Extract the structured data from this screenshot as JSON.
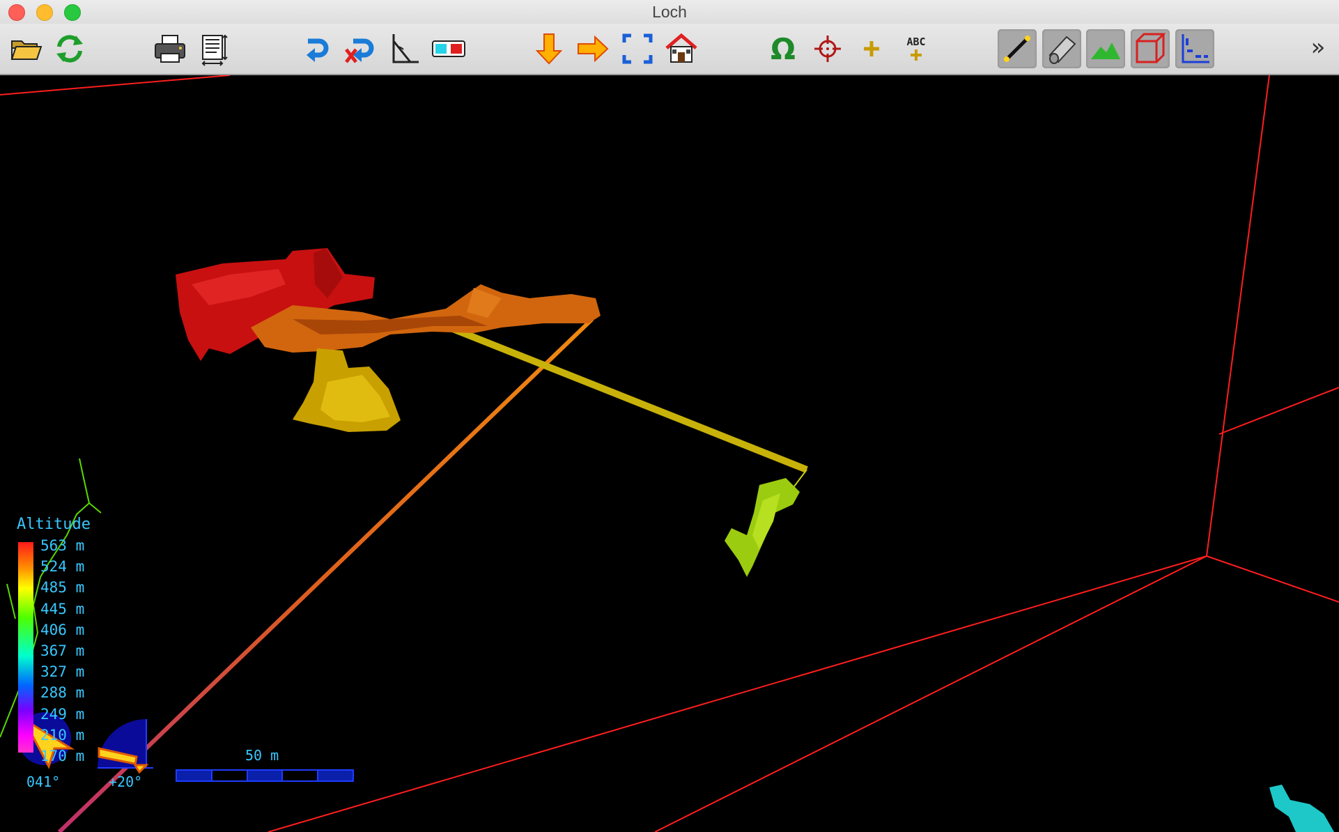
{
  "window": {
    "title": "Loch"
  },
  "toolbar": {
    "buttons": [
      {
        "name": "open",
        "icon": "folder-open-icon"
      },
      {
        "name": "reload",
        "icon": "reload-icon"
      },
      {
        "name": "print",
        "icon": "printer-icon"
      },
      {
        "name": "page-setup",
        "icon": "page-setup-icon"
      },
      {
        "name": "rotate",
        "icon": "rotate-icon"
      },
      {
        "name": "cancel-rotation",
        "icon": "stop-rotate-icon"
      },
      {
        "name": "perspective",
        "icon": "perspective-icon"
      },
      {
        "name": "anaglyph",
        "icon": "3d-glasses-icon"
      },
      {
        "name": "view-plan",
        "icon": "arrow-down-icon"
      },
      {
        "name": "view-elevation",
        "icon": "arrow-right-icon"
      },
      {
        "name": "zoom-to-fit",
        "icon": "fit-to-screen-icon"
      },
      {
        "name": "home",
        "icon": "home-icon"
      },
      {
        "name": "highlight-entrances",
        "icon": "omega-icon"
      },
      {
        "name": "highlight-fixed-points",
        "icon": "crosshair-icon"
      },
      {
        "name": "highlight-stations",
        "icon": "plus-icon"
      },
      {
        "name": "show-labels",
        "icon": "abc-labels-icon"
      },
      {
        "name": "show-centerline",
        "icon": "centerline-icon",
        "pressed": true
      },
      {
        "name": "show-walls",
        "icon": "tube-walls-icon",
        "pressed": true
      },
      {
        "name": "show-surface",
        "icon": "surface-icon",
        "pressed": true
      },
      {
        "name": "show-bounding-box",
        "icon": "bounding-box-icon",
        "pressed": true
      },
      {
        "name": "show-indicators",
        "icon": "indicators-icon",
        "pressed": true
      }
    ],
    "overflow_label": "»"
  },
  "legend": {
    "title": "Altitude",
    "labels": [
      "563 m",
      "524 m",
      "485 m",
      "445 m",
      "406 m",
      "367 m",
      "327 m",
      "288 m",
      "249 m",
      "210 m",
      "170 m"
    ]
  },
  "compass": {
    "bearing": "041°"
  },
  "clino": {
    "tilt": "+20°"
  },
  "scale": {
    "label": "50 m"
  },
  "colors": {
    "background": "#000000",
    "bounding_box": "#ff1e1e",
    "indicator_text": "#37c8ff",
    "compass_fill": "#0b0b9a",
    "compass_arrow": "#ffd21e"
  }
}
